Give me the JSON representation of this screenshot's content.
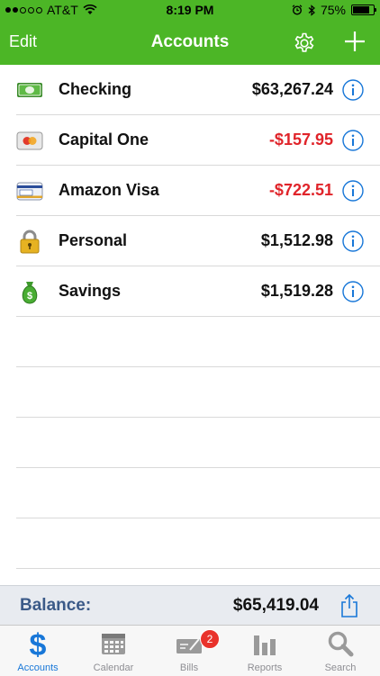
{
  "status_bar": {
    "carrier": "AT&T",
    "time": "8:19 PM",
    "battery": "75%",
    "battery_level": 0.75
  },
  "nav": {
    "edit_label": "Edit",
    "title": "Accounts",
    "settings_icon": "gear-icon",
    "add_icon": "plus-icon"
  },
  "accounts": [
    {
      "name": "Checking",
      "amount": "$63,267.24",
      "negative": false,
      "icon": "cash-icon"
    },
    {
      "name": "Capital One",
      "amount": "-$157.95",
      "negative": true,
      "icon": "mastercard-icon"
    },
    {
      "name": "Amazon Visa",
      "amount": "-$722.51",
      "negative": true,
      "icon": "visa-card-icon"
    },
    {
      "name": "Personal",
      "amount": "$1,512.98",
      "negative": false,
      "icon": "padlock-icon"
    },
    {
      "name": "Savings",
      "amount": "$1,519.28",
      "negative": false,
      "icon": "money-bag-icon"
    }
  ],
  "balance": {
    "label": "Balance:",
    "value": "$65,419.04"
  },
  "tabs": [
    {
      "label": "Accounts",
      "icon": "dollar-icon",
      "active": true
    },
    {
      "label": "Calendar",
      "icon": "calendar-icon",
      "active": false
    },
    {
      "label": "Bills",
      "icon": "check-icon",
      "active": false,
      "badge": "2"
    },
    {
      "label": "Reports",
      "icon": "bar-chart-icon",
      "active": false
    },
    {
      "label": "Search",
      "icon": "magnifier-icon",
      "active": false
    }
  ],
  "colors": {
    "nav_green": "#4cb626",
    "negative_red": "#e0242a",
    "info_blue": "#1877d8",
    "balance_label": "#3b5a88"
  }
}
